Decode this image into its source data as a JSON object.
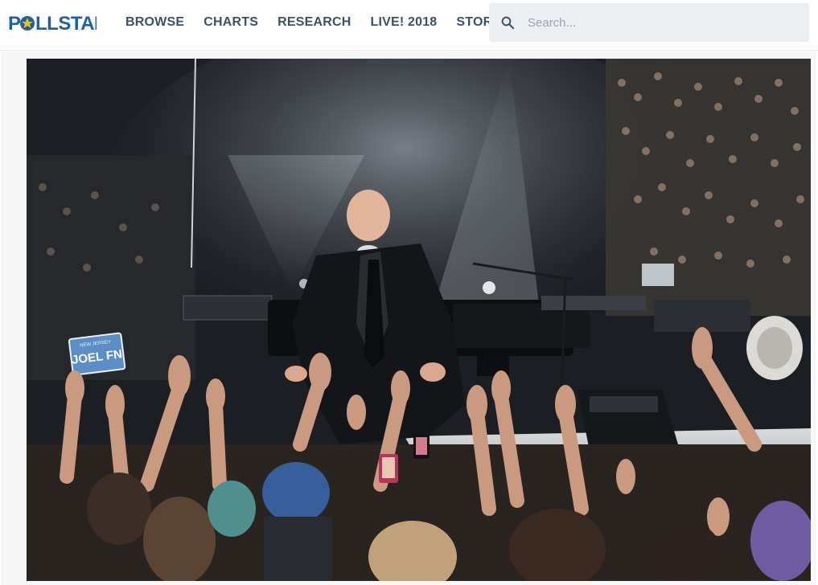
{
  "header": {
    "logo_text": "POLLSTAR",
    "nav": [
      {
        "label": "BROWSE"
      },
      {
        "label": "CHARTS"
      },
      {
        "label": "RESEARCH"
      },
      {
        "label": "LIVE! 2018"
      },
      {
        "label": "STORE"
      }
    ],
    "search": {
      "placeholder": "Search..."
    }
  },
  "hero": {
    "sign_text": "JOEL FN",
    "sign_top_text": "NEW JERSEY"
  },
  "colors": {
    "brand_blue": "#1f5fa8",
    "brand_star": "#f2c300",
    "nav_text": "#3d4f6b",
    "search_bg": "#eceff2"
  }
}
